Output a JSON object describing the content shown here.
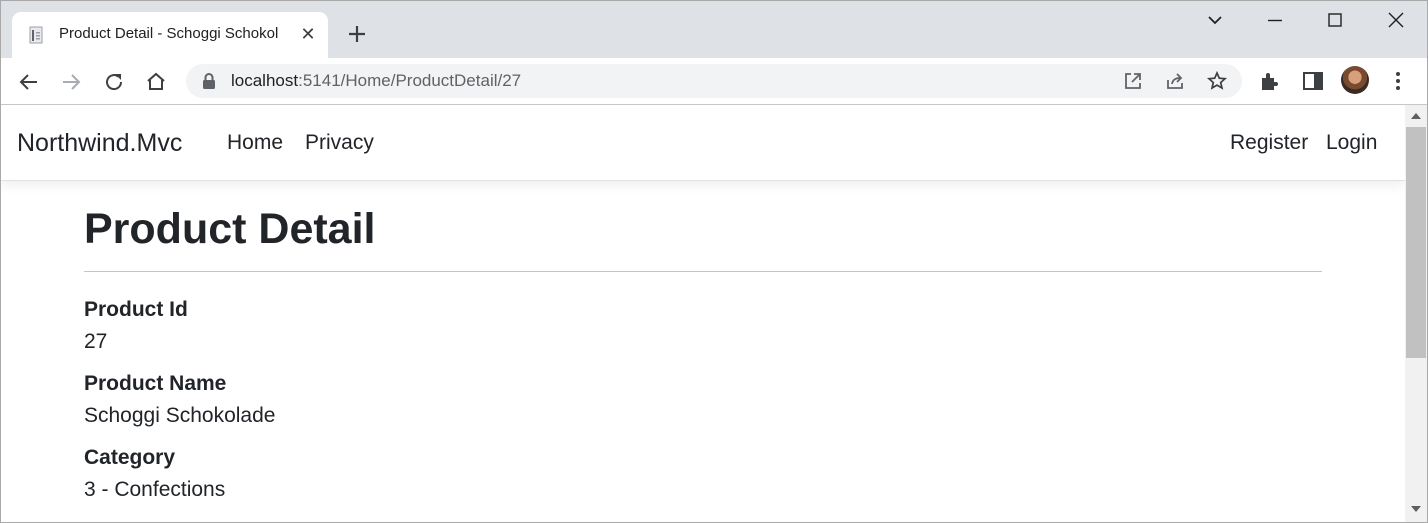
{
  "browser": {
    "tab_title": "Product Detail - Schoggi Schokol",
    "url_host": "localhost",
    "url_path": ":5141/Home/ProductDetail/27",
    "icons": [
      "tab-favicon-icon",
      "close-icon",
      "plus-icon",
      "chevron-down-icon",
      "minimize-icon",
      "maximize-icon",
      "close-window-icon",
      "back-arrow-icon",
      "forward-arrow-icon",
      "reload-icon",
      "home-icon",
      "lock-icon",
      "open-in-app-icon",
      "share-icon",
      "star-icon",
      "extensions-icon",
      "side-panel-icon",
      "avatar",
      "more-vert-icon"
    ]
  },
  "site": {
    "brand": "Northwind.Mvc",
    "nav_left": [
      "Home",
      "Privacy"
    ],
    "nav_right": [
      "Register",
      "Login"
    ]
  },
  "page": {
    "title": "Product Detail",
    "fields": [
      {
        "label": "Product Id",
        "value": "27"
      },
      {
        "label": "Product Name",
        "value": "Schoggi Schokolade"
      },
      {
        "label": "Category",
        "value": "3 - Confections"
      }
    ]
  }
}
